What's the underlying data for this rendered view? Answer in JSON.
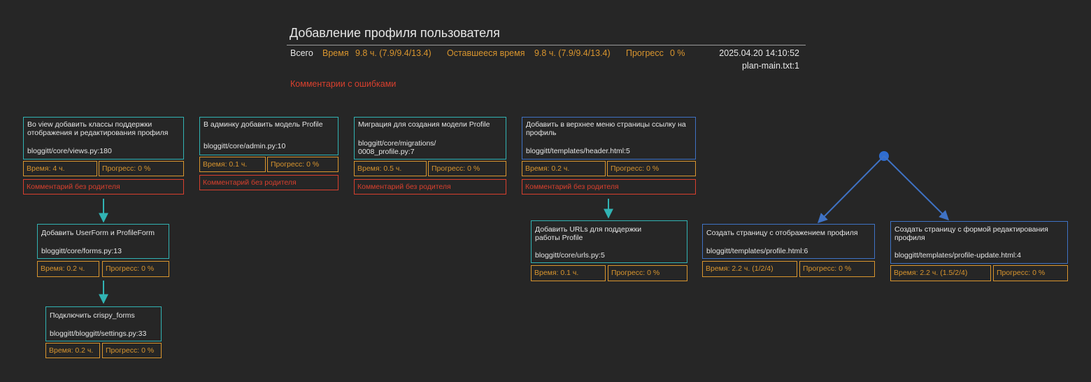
{
  "header": {
    "title": "Добавление профиля пользователя",
    "total_label": "Всего",
    "time_label": "Время",
    "time_value": "9.8 ч. (7.9/9.4/13.4)",
    "remaining_label": "Оставшееся время",
    "remaining_value": "9.8 ч. (7.9/9.4/13.4)",
    "progress_label": "Прогресс",
    "progress_value": "0 %",
    "datetime": "2025.04.20 14:10:52",
    "file": "plan-main.txt:1",
    "errors_label": "Комментарии с ошибками"
  },
  "colors": {
    "background": "#262626",
    "teal": "#31b3b3",
    "blue": "#3f72c4",
    "orange": "#d9952e",
    "red": "#d9402e",
    "text": "#e6e6e6"
  },
  "nodes": [
    {
      "title": "Во view добавить классы поддержки отображения и редактирования профиля",
      "file": "bloggitt/core/views.py:180",
      "time": "Время: 4 ч.",
      "progress": "Прогресс: 0 %",
      "comment": "Комментарий без родителя"
    },
    {
      "title": "В админку добавить модель Profile",
      "file": "bloggitt/core/admin.py:10",
      "time": "Время: 0.1 ч.",
      "progress": "Прогресс: 0 %",
      "comment": "Комментарий без родителя"
    },
    {
      "title": "Миграция для создания модели Profile",
      "file": "bloggitt/core/migrations/\n0008_profile.py:7",
      "time": "Время: 0.5 ч.",
      "progress": "Прогресс: 0 %",
      "comment": "Комментарий без родителя"
    },
    {
      "title": "Добавить в верхнее меню страницы ссылку на профиль",
      "file": "bloggitt/templates/header.html:5",
      "time": "Время: 0.2 ч.",
      "progress": "Прогресс: 0 %",
      "comment": "Комментарий без родителя"
    },
    {
      "title": "Добавить UserForm и ProfileForm",
      "file": "bloggitt/core/forms.py:13",
      "time": "Время: 0.2 ч.",
      "progress": "Прогресс: 0 %"
    },
    {
      "title": "Подключить crispy_forms",
      "file": "bloggitt/bloggitt/settings.py:33",
      "time": "Время: 0.2 ч.",
      "progress": "Прогресс: 0 %"
    },
    {
      "title": "Добавить URLs для поддержки работы Profile",
      "file": "bloggitt/core/urls.py:5",
      "time": "Время: 0.1 ч.",
      "progress": "Прогресс: 0 %"
    },
    {
      "title": "Создать страницу с отображением профиля",
      "file": "bloggitt/templates/profile.html:6",
      "time": "Время: 2.2 ч. (1/2/4)",
      "progress": "Прогресс: 0 %"
    },
    {
      "title": "Создать страницу с формой редактирования профиля",
      "file": "bloggitt/templates/profile-update.html:4",
      "time": "Время: 2.2 ч. (1.5/2/4)",
      "progress": "Прогресс: 0 %"
    }
  ]
}
